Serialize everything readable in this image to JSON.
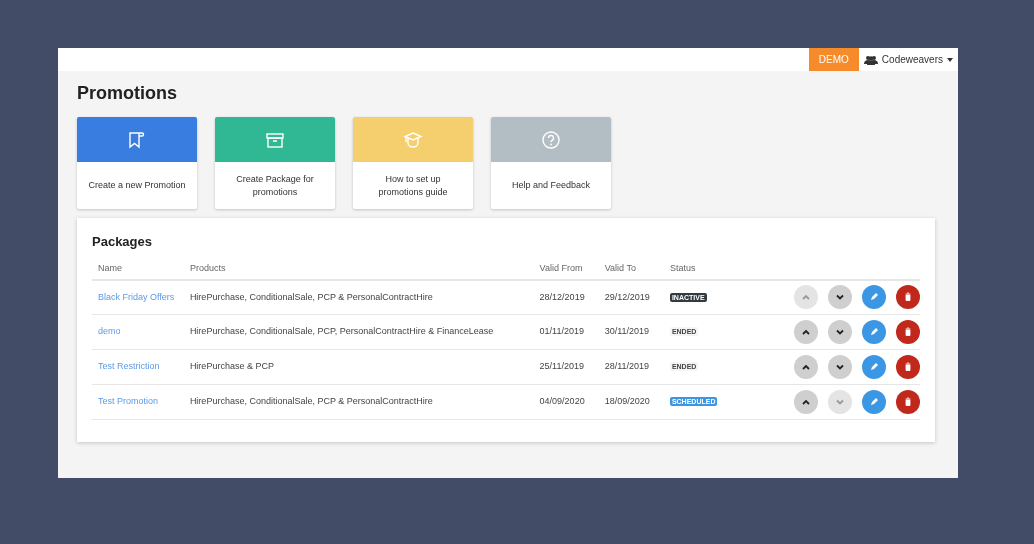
{
  "top_bar": {
    "demo_badge": "DEMO",
    "user_menu": "Codeweavers"
  },
  "page_title": "Promotions",
  "tiles": [
    {
      "kind": "promotion",
      "label": "Create a new Promotion",
      "color": "#3a7de0"
    },
    {
      "kind": "package",
      "label": "Create Package for promotions",
      "color": "#2fb893"
    },
    {
      "kind": "guide",
      "label": "How to set up promotions guide",
      "color": "#f5cf6e"
    },
    {
      "kind": "help",
      "label": "Help and Feedback",
      "color": "#b3bec4"
    }
  ],
  "packages": {
    "title": "Packages",
    "columns": [
      "Name",
      "Products",
      "Valid From",
      "Valid To",
      "Status"
    ],
    "rows": [
      {
        "name": "Black Friday Offers",
        "products": "HirePurchase, ConditionalSale, PCP & PersonalContractHire",
        "valid_from": "28/12/2019",
        "valid_to": "29/12/2019",
        "status": "INACTIVE",
        "kind": "inactive",
        "up_disabled": true,
        "down_disabled": false
      },
      {
        "name": "demo",
        "products": "HirePurchase, ConditionalSale, PCP, PersonalContractHire & FinanceLease",
        "valid_from": "01/11/2019",
        "valid_to": "30/11/2019",
        "status": "ENDED",
        "kind": "ended",
        "up_disabled": false,
        "down_disabled": false
      },
      {
        "name": "Test Restriction",
        "products": "HirePurchase & PCP",
        "valid_from": "25/11/2019",
        "valid_to": "28/11/2019",
        "status": "ENDED",
        "kind": "ended",
        "up_disabled": false,
        "down_disabled": false
      },
      {
        "name": "Test Promotion",
        "products": "HirePurchase, ConditionalSale, PCP & PersonalContractHire",
        "valid_from": "04/09/2020",
        "valid_to": "18/09/2020",
        "status": "SCHEDULED",
        "kind": "scheduled",
        "up_disabled": false,
        "down_disabled": true
      }
    ]
  }
}
